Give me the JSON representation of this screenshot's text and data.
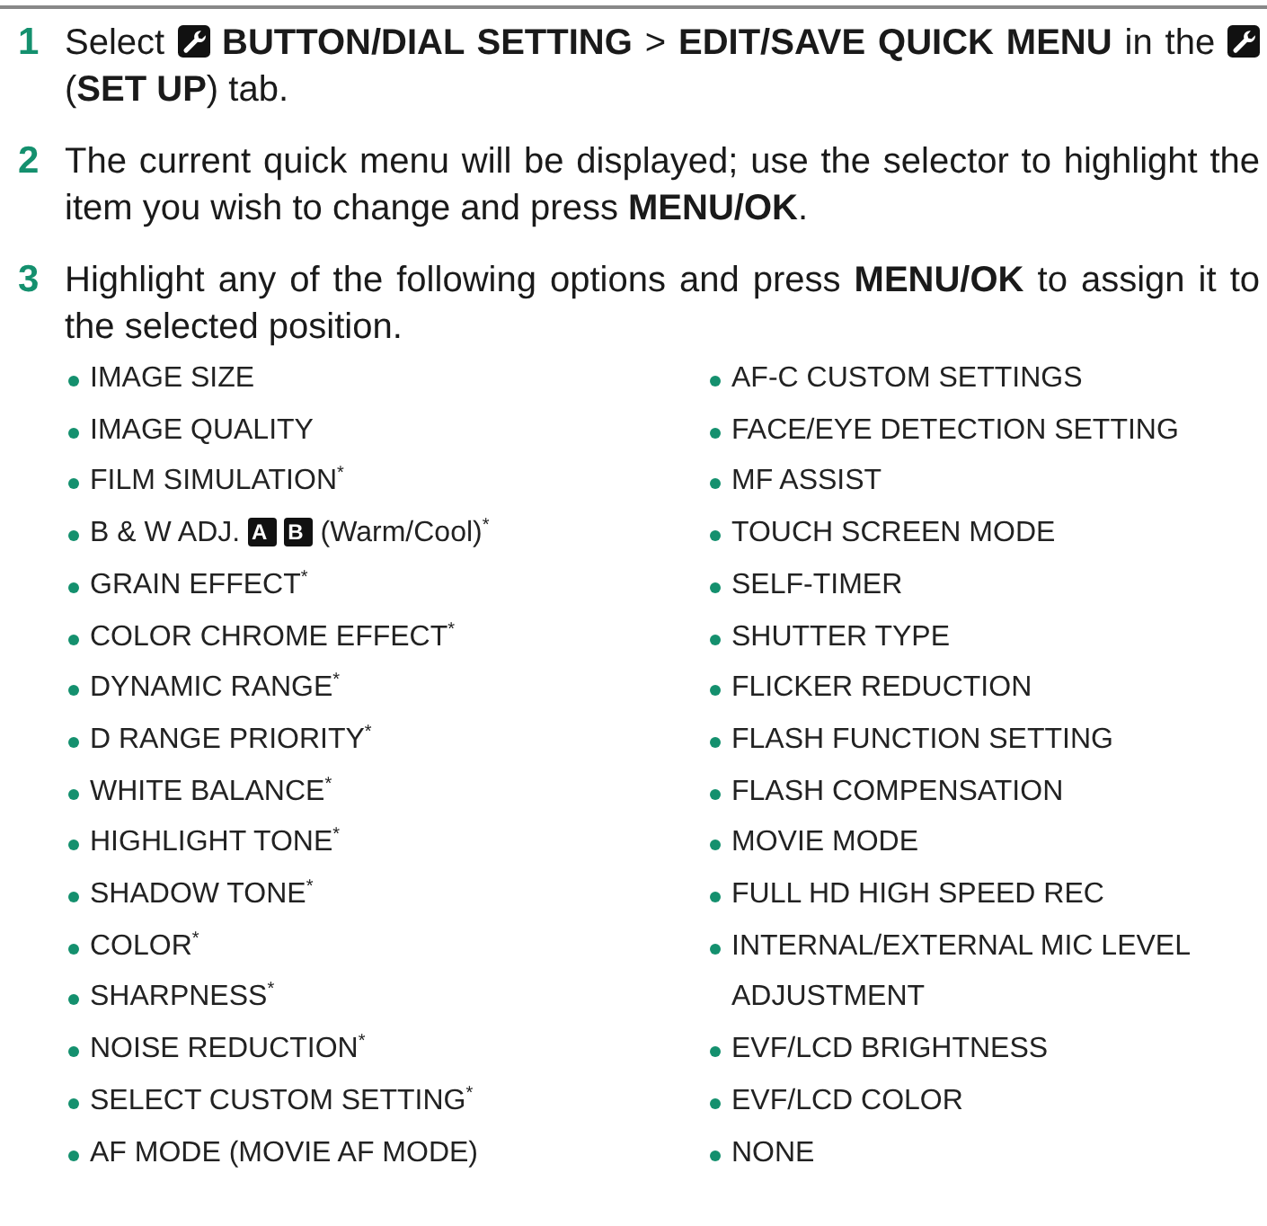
{
  "steps": [
    {
      "number": "1",
      "parts": [
        {
          "kind": "text",
          "text": "Select"
        },
        {
          "kind": "wrench-icon"
        },
        {
          "kind": "text",
          "text": "**BUTTON/DIAL SETTING** > **EDIT/SAVE QUICK MENU** in the"
        },
        {
          "kind": "wrench-icon"
        },
        {
          "kind": "text",
          "text": "(**SET UP**) tab."
        }
      ]
    },
    {
      "number": "2",
      "parts": [
        {
          "kind": "text",
          "text": "The current quick menu will be displayed; use the selector to highlight the item you wish to change and press **MENU/OK**."
        }
      ]
    },
    {
      "number": "3",
      "parts": [
        {
          "kind": "text",
          "text": "Highlight any of the following options and press **MENU/OK** to assign it to the selected position."
        }
      ],
      "columns": [
        [
          {
            "parts": [
              {
                "kind": "text",
                "text": "IMAGE SIZE"
              }
            ]
          },
          {
            "parts": [
              {
                "kind": "text",
                "text": "IMAGE QUALITY"
              }
            ]
          },
          {
            "parts": [
              {
                "kind": "text",
                "text": "FILM SIMULATION$^{*}$"
              }
            ]
          },
          {
            "parts": [
              {
                "kind": "text",
                "text": "B & W ADJ."
              },
              {
                "kind": "film-tag",
                "text": "A"
              },
              {
                "kind": "film-tag",
                "text": "B"
              },
              {
                "kind": "text",
                "text": "(Warm/Cool)$^{*}$"
              }
            ]
          },
          {
            "parts": [
              {
                "kind": "text",
                "text": "GRAIN EFFECT$^{*}$"
              }
            ]
          },
          {
            "parts": [
              {
                "kind": "text",
                "text": "COLOR CHROME EFFECT$^{*}$"
              }
            ]
          },
          {
            "parts": [
              {
                "kind": "text",
                "text": "DYNAMIC RANGE$^{*}$"
              }
            ]
          },
          {
            "parts": [
              {
                "kind": "text",
                "text": "D RANGE PRIORITY$^{*}$"
              }
            ]
          },
          {
            "parts": [
              {
                "kind": "text",
                "text": "WHITE BALANCE$^{*}$"
              }
            ]
          },
          {
            "parts": [
              {
                "kind": "text",
                "text": "HIGHLIGHT TONE$^{*}$"
              }
            ]
          },
          {
            "parts": [
              {
                "kind": "text",
                "text": "SHADOW TONE$^{*}$"
              }
            ]
          },
          {
            "parts": [
              {
                "kind": "text",
                "text": "COLOR$^{*}$"
              }
            ]
          },
          {
            "parts": [
              {
                "kind": "text",
                "text": "SHARPNESS$^{*}$"
              }
            ]
          },
          {
            "parts": [
              {
                "kind": "text",
                "text": "NOISE REDUCTION$^{*}$"
              }
            ]
          },
          {
            "parts": [
              {
                "kind": "text",
                "text": "SELECT CUSTOM SETTING$^{*}$"
              }
            ]
          },
          {
            "parts": [
              {
                "kind": "text",
                "text": "AF MODE (MOVIE AF MODE)"
              }
            ]
          }
        ],
        [
          {
            "parts": [
              {
                "kind": "text",
                "text": "AF-C CUSTOM SETTINGS"
              }
            ]
          },
          {
            "parts": [
              {
                "kind": "text",
                "text": "FACE/EYE DETECTION SETTING"
              }
            ]
          },
          {
            "parts": [
              {
                "kind": "text",
                "text": "MF ASSIST"
              }
            ]
          },
          {
            "parts": [
              {
                "kind": "text",
                "text": "TOUCH SCREEN MODE"
              }
            ]
          },
          {
            "parts": [
              {
                "kind": "text",
                "text": "SELF-TIMER"
              }
            ]
          },
          {
            "parts": [
              {
                "kind": "text",
                "text": "SHUTTER TYPE"
              }
            ]
          },
          {
            "parts": [
              {
                "kind": "text",
                "text": "FLICKER REDUCTION"
              }
            ]
          },
          {
            "parts": [
              {
                "kind": "text",
                "text": "FLASH FUNCTION SETTING"
              }
            ]
          },
          {
            "parts": [
              {
                "kind": "text",
                "text": "FLASH COMPENSATION"
              }
            ]
          },
          {
            "parts": [
              {
                "kind": "text",
                "text": "MOVIE MODE"
              }
            ]
          },
          {
            "parts": [
              {
                "kind": "text",
                "text": "FULL HD HIGH SPEED REC"
              }
            ]
          },
          {
            "parts": [
              {
                "kind": "text",
                "text": "INTERNAL/EXTERNAL MIC LEVEL ADJUSTMENT"
              }
            ]
          },
          {
            "parts": [
              {
                "kind": "text",
                "text": "EVF/LCD BRIGHTNESS"
              }
            ]
          },
          {
            "parts": [
              {
                "kind": "text",
                "text": "EVF/LCD COLOR"
              }
            ]
          },
          {
            "parts": [
              {
                "kind": "text",
                "text": "NONE"
              }
            ]
          }
        ]
      ]
    }
  ]
}
